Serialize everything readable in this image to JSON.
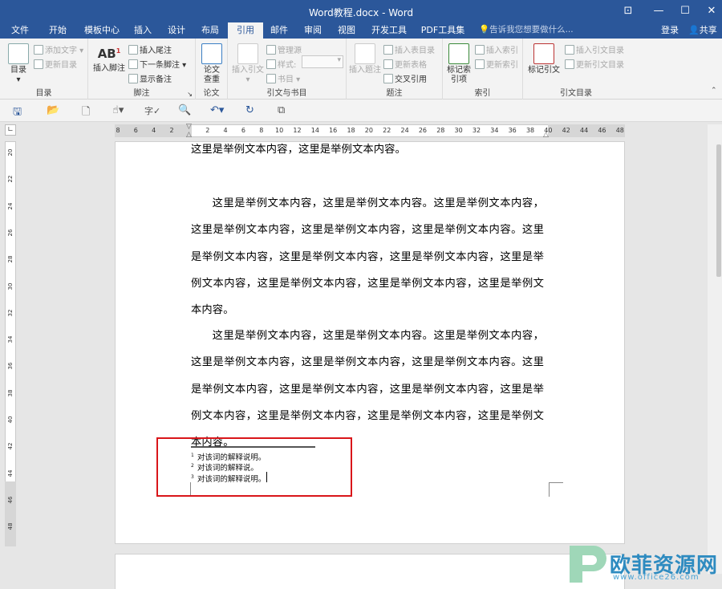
{
  "titlebar": {
    "title": "Word教程.docx - Word"
  },
  "tabs": [
    "文件",
    "开始",
    "模板中心",
    "插入",
    "设计",
    "布局",
    "引用",
    "邮件",
    "审阅",
    "视图",
    "开发工具",
    "PDF工具集"
  ],
  "tell_me": "告诉我您想要做什么...",
  "login": "登录",
  "share": "共享",
  "ribbon": {
    "toc": {
      "label": "目录",
      "group": "目录",
      "add_text": "添加文字",
      "update_toc": "更新目录"
    },
    "footnotes": {
      "insert_footnote": "插入脚注",
      "insert_endnote": "插入尾注",
      "next_footnote": "下一条脚注",
      "show_notes": "显示备注",
      "group": "脚注"
    },
    "research": {
      "paper_search": "论文查重",
      "group": "论文"
    },
    "citations": {
      "insert_citation": "插入引文",
      "manage_sources": "管理源",
      "style": "样式:",
      "bibliography": "书目",
      "group": "引文与书目"
    },
    "captions": {
      "insert_caption": "插入题注",
      "insert_table_of_figures": "插入表目录",
      "update_table": "更新表格",
      "cross_reference": "交叉引用",
      "group": "题注"
    },
    "index": {
      "mark_entry": "标记索引项",
      "insert_index": "插入索引",
      "update_index": "更新索引",
      "group": "索引"
    },
    "toa": {
      "mark_citation": "标记引文",
      "insert_toa": "插入引文目录",
      "update_toa": "更新引文目录",
      "group": "引文目录"
    }
  },
  "document": {
    "para0": "这里是举例文本内容，这里是举例文本内容。",
    "para1": "这里是举例文本内容，这里是举例文本内容。这里是举例文本内容，这里是举例文本内容，这里是举例文本内容，这里是举例文本内容。这里是举例文本内容，这里是举例文本内容，这里是举例文本内容，这里是举例文本内容，这里是举例文本内容，这里是举例文本内容，这里是举例文本内容。",
    "para2": "这里是举例文本内容，这里是举例文本内容。这里是举例文本内容，这里是举例文本内容，这里是举例文本内容，这里是举例文本内容。这里是举例文本内容，这里是举例文本内容，这里是举例文本内容，这里是举例文本内容，这里是举例文本内容，这里是举例文本内容，这里是举例文本内容。",
    "footnotes": [
      {
        "num": "1",
        "text": "对该词的解释说明。"
      },
      {
        "num": "2",
        "text": "对该词的解释说。"
      },
      {
        "num": "3",
        "text": "对该词的解释说明。"
      }
    ]
  },
  "ruler": {
    "h_ticks": [
      "8",
      "6",
      "4",
      "2",
      "2",
      "4",
      "6",
      "8",
      "10",
      "12",
      "14",
      "16",
      "18",
      "20",
      "22",
      "24",
      "26",
      "28",
      "30",
      "32",
      "34",
      "36",
      "38",
      "40",
      "42",
      "44",
      "46",
      "48"
    ],
    "v_ticks": [
      "20",
      "22",
      "24",
      "26",
      "28",
      "30",
      "32",
      "34",
      "36",
      "38",
      "40",
      "42",
      "44",
      "46",
      "48"
    ]
  },
  "watermark": {
    "text": "欧菲资源网",
    "url": "www.office26.com"
  },
  "colors": {
    "brand": "#2b579a",
    "highlight_box": "#d9161a"
  }
}
